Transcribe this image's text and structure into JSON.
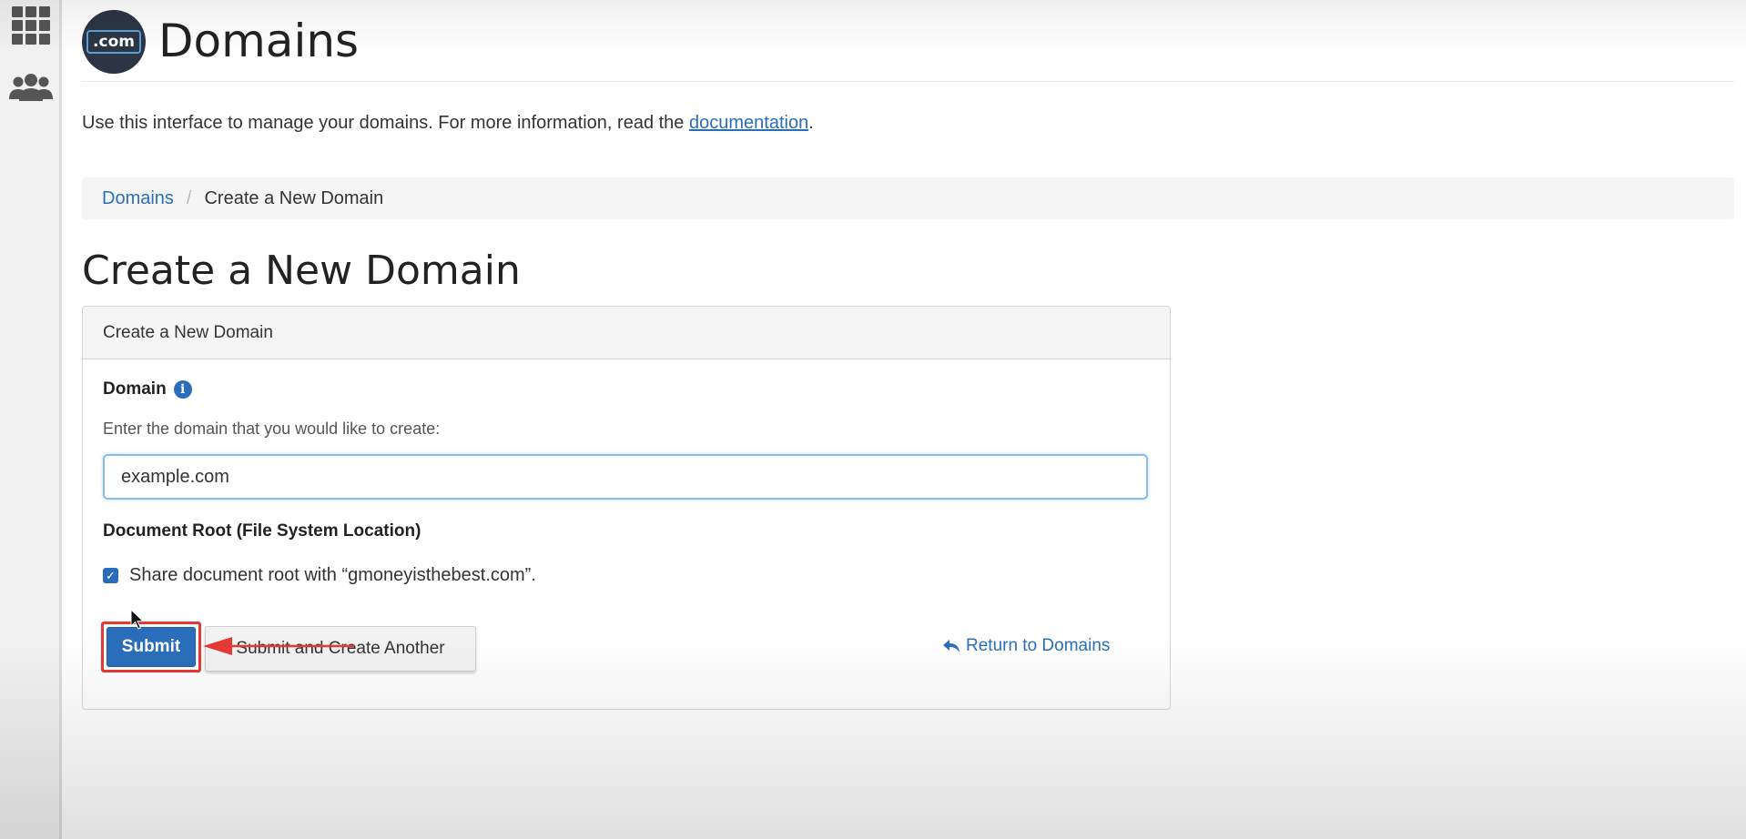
{
  "sidebar": {
    "items": [
      {
        "icon": "apps-grid-icon"
      },
      {
        "icon": "users-icon"
      }
    ]
  },
  "header": {
    "logo_text": ".com",
    "title": "Domains"
  },
  "intro": {
    "text": "Use this interface to manage your domains. For more information, read the ",
    "link_text": "documentation",
    "suffix": "."
  },
  "breadcrumb": {
    "items": [
      {
        "label": "Domains"
      },
      {
        "label": "Create a New Domain"
      }
    ],
    "separator": "/"
  },
  "section_title": "Create a New Domain",
  "panel": {
    "heading": "Create a New Domain",
    "domain_label": "Domain",
    "info_glyph": "i",
    "help_text": "Enter the domain that you would like to create:",
    "domain_value": "example.com",
    "doc_root_label": "Document Root (File System Location)",
    "share_checked": true,
    "share_label": "Share document root with “gmoneyisthebest.com”.",
    "submit_label": "Submit",
    "submit_another_label": "Submit and Create Another",
    "return_label": "Return to Domains"
  },
  "colors": {
    "accent": "#2a6ebb",
    "annotation": "#e53935"
  }
}
